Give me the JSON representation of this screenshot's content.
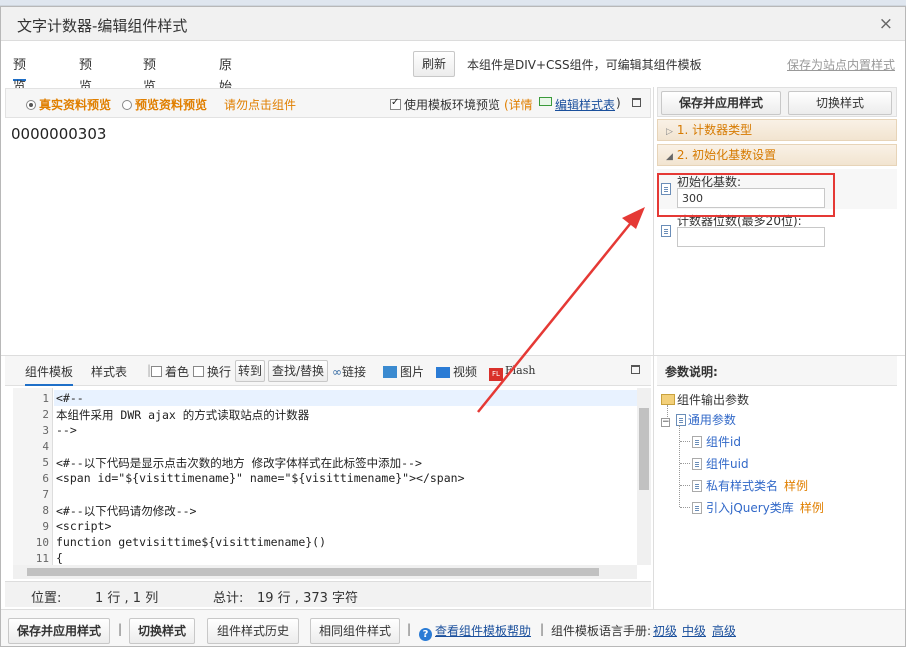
{
  "dialog": {
    "title": "文字计数器-编辑组件样式",
    "close": "×"
  },
  "tabs": [
    "预览组件",
    "预览代码",
    "预览样式表",
    "原始代码"
  ],
  "toolbar": {
    "refresh_label": "刷新",
    "info_text": "本组件是DIV+CSS组件，可编辑其组件模板",
    "save_to_inner": "保存为站点内置样式"
  },
  "preview_bar": {
    "radio_real": "真实资料预览",
    "radio_preview": "预览资料预览",
    "warning": "请勿点击组件",
    "checkbox_label": "使用模板环境预览",
    "details": "(详情",
    "edit_stylesheet": "编辑样式表",
    "paren_close": ")"
  },
  "preview": {
    "counter_value": "0000000303"
  },
  "right_panel": {
    "save_apply": "保存并应用样式",
    "switch_style": "切换样式",
    "section1": "1. 计数器类型",
    "section2": "2. 初始化基数设置",
    "field1_label": "初始化基数:",
    "field1_value": "300",
    "field2_label": "计数器位数(最多20位):",
    "field2_value": ""
  },
  "editor_toolbar": {
    "tab_template": "组件模板",
    "tab_stylesheet": "样式表",
    "color": "着色",
    "wrap": "换行",
    "goto": "转到",
    "find_replace": "查找/替换",
    "link": "链接",
    "image": "图片",
    "video": "视频",
    "flash": "Flash",
    "flash_icon": "FL"
  },
  "code_lines": [
    {
      "n": "1",
      "text": "<#--"
    },
    {
      "n": "2",
      "text": "本组件采用 DWR ajax 的方式读取站点的计数器"
    },
    {
      "n": "3",
      "text": "-->"
    },
    {
      "n": "4",
      "text": ""
    },
    {
      "n": "5",
      "text": "<#--以下代码是显示点击次数的地方 修改字体样式在此标签中添加-->"
    },
    {
      "n": "6",
      "text": "<span id=\"${visittimename}\" name=\"${visittimename}\"></span>"
    },
    {
      "n": "7",
      "text": ""
    },
    {
      "n": "8",
      "text": "<#--以下代码请勿修改-->"
    },
    {
      "n": "9",
      "text": "<script>"
    },
    {
      "n": "10",
      "text": "function getvisittime${visittimename}()"
    },
    {
      "n": "11",
      "text": "{"
    }
  ],
  "status": {
    "pos_label": "位置:",
    "pos_value": "1 行 , 1 列",
    "total_label": "总计:",
    "total_value": "19 行 , 373 字符"
  },
  "params": {
    "title": "参数说明:",
    "root": "组件输出参数",
    "group": "通用参数",
    "items": [
      {
        "label": "组件id",
        "example": ""
      },
      {
        "label": "组件uid",
        "example": ""
      },
      {
        "label": "私有样式类名",
        "example": "样例"
      },
      {
        "label": "引入jQuery类库",
        "example": "样例"
      }
    ]
  },
  "footer": {
    "save_apply": "保存并应用样式",
    "switch_style": "切换样式",
    "history": "组件样式历史",
    "same": "相同组件样式",
    "help": "查看组件模板帮助",
    "manual": "组件模板语言手册:",
    "beginner": "初级",
    "middle": "中级",
    "advanced": "高级"
  }
}
